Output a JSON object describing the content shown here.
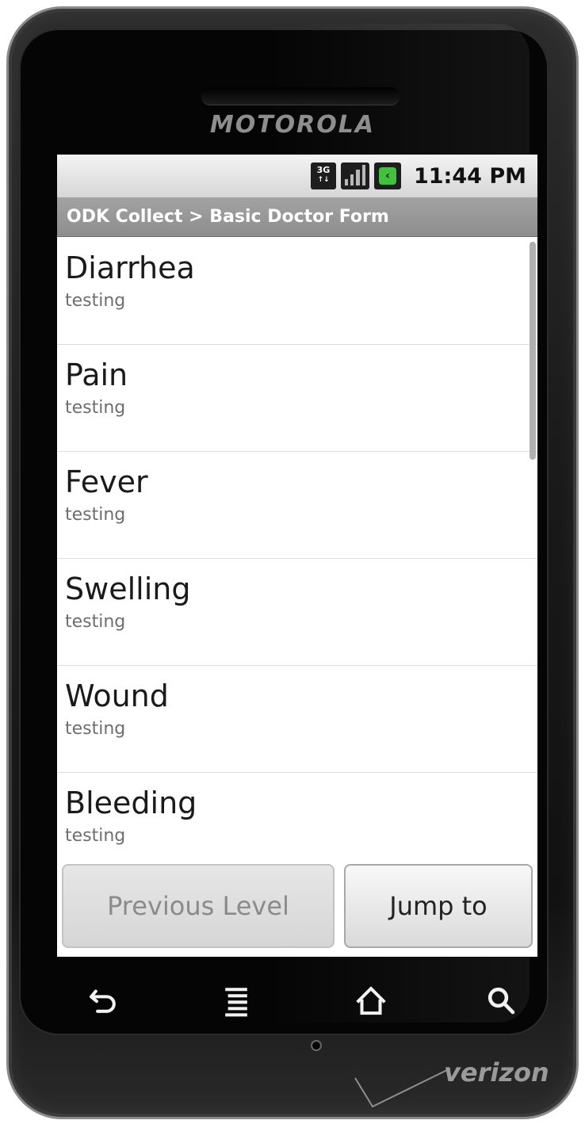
{
  "device": {
    "brand": "MOTOROLA",
    "carrier": "verizon"
  },
  "status_bar": {
    "network_icon": "3g-icon",
    "network_label": "3G",
    "signal_icon": "signal-strength-icon",
    "battery_icon": "battery-charging-icon",
    "time": "11:44 PM"
  },
  "title_bar": {
    "text": "ODK Collect > Basic Doctor Form"
  },
  "list": {
    "items": [
      {
        "title": "Diarrhea",
        "subtitle": "testing"
      },
      {
        "title": "Pain",
        "subtitle": "testing"
      },
      {
        "title": "Fever",
        "subtitle": "testing"
      },
      {
        "title": "Swelling",
        "subtitle": "testing"
      },
      {
        "title": "Wound",
        "subtitle": "testing"
      },
      {
        "title": "Bleeding",
        "subtitle": "testing"
      }
    ]
  },
  "buttons": {
    "previous_level": "Previous Level",
    "jump_to": "Jump to"
  },
  "hardware_keys": [
    "back-icon",
    "menu-icon",
    "home-icon",
    "search-icon"
  ],
  "colors": {
    "title_bar": "#999999",
    "status_bar": "#e4e4e4",
    "battery_green": "#43c13e"
  }
}
